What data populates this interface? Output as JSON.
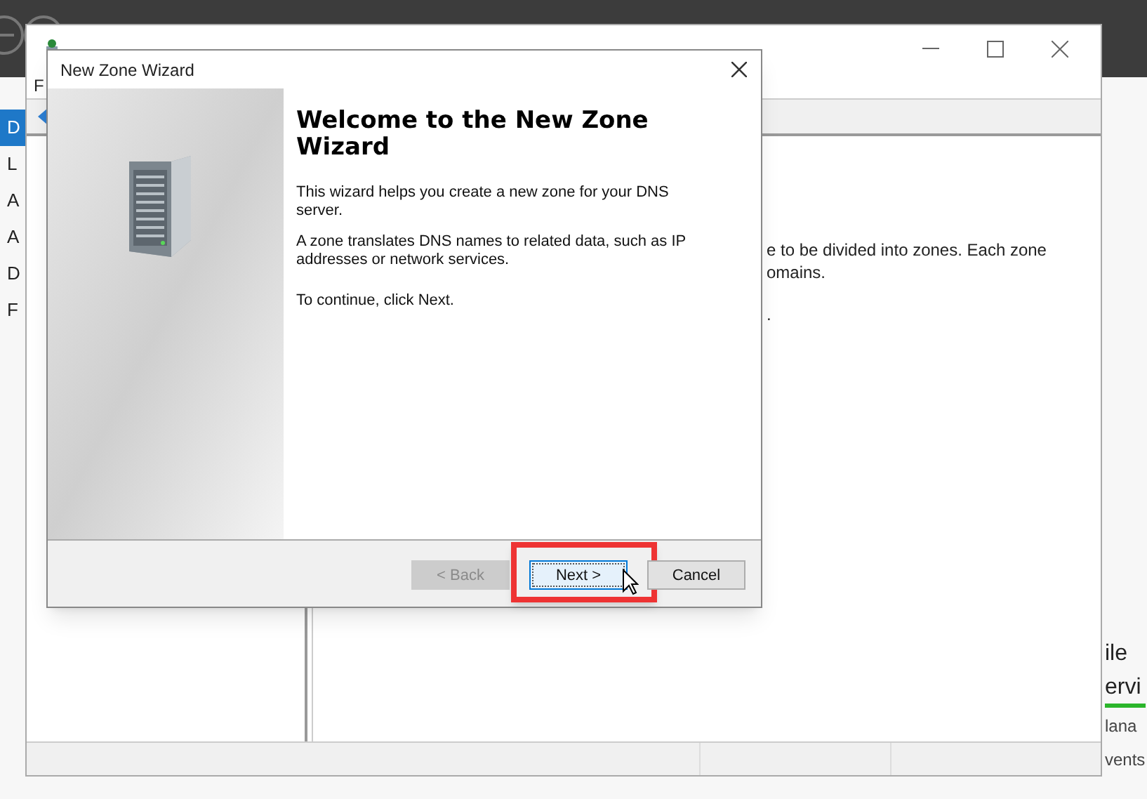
{
  "server_manager": {
    "sidebar_items": [
      {
        "label": "D",
        "selected": true
      },
      {
        "label": "L",
        "selected": false
      },
      {
        "label": "A",
        "selected": false
      },
      {
        "label": "A",
        "selected": false
      },
      {
        "label": "D",
        "selected": false
      },
      {
        "label": "F",
        "selected": false
      }
    ],
    "tiles": [
      {
        "label": "ile",
        "kind": "heading"
      },
      {
        "label": "ervi",
        "kind": "status"
      },
      {
        "label": "lana",
        "kind": "link"
      },
      {
        "label": "vents",
        "kind": "link"
      }
    ]
  },
  "dns_manager": {
    "menu": [
      "F"
    ],
    "details_text": [
      "e to be divided into zones. Each zone",
      "omains.",
      "."
    ]
  },
  "wizard": {
    "title": "New Zone Wizard",
    "heading": "Welcome to the New Zone Wizard",
    "paragraphs": [
      "This wizard helps you create a new zone for your DNS server.",
      "A zone translates DNS names to related data, such as IP addresses or network services.",
      "To continue, click Next."
    ],
    "buttons": [
      {
        "label": "< Back",
        "disabled": true,
        "focused": false,
        "highlighted": false
      },
      {
        "label": "Next >",
        "disabled": false,
        "focused": true,
        "highlighted": true
      },
      {
        "label": "Cancel",
        "disabled": false,
        "focused": false,
        "highlighted": false
      }
    ]
  }
}
